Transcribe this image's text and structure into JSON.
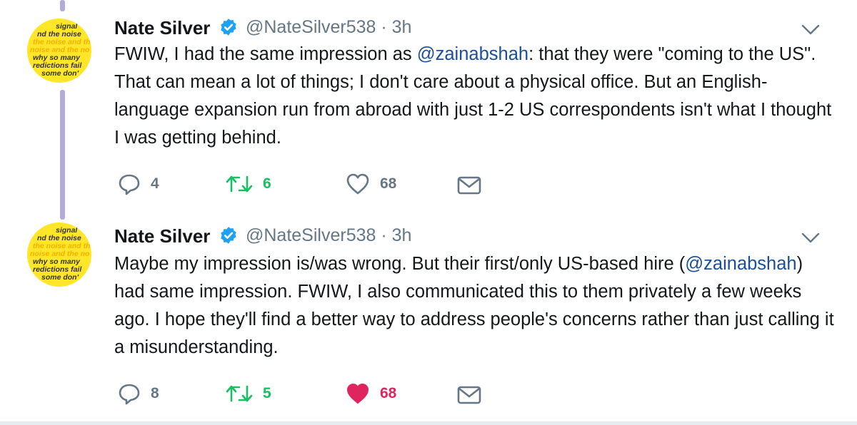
{
  "tweets": [
    {
      "author_name": "Nate Silver",
      "handle": "@NateSilver538",
      "separator": "·",
      "time": "3h",
      "text_before": "FWIW, I had the same impression as ",
      "mention": "@zainabshah",
      "text_after": ": that they were \"coming to the US\". That can mean a lot of things; I don't care about a physical office. But an English-language expansion run from abroad with just 1-2 US correspondents isn't what I thought I was getting behind.",
      "replies": "4",
      "retweets": "6",
      "likes": "68",
      "liked": false,
      "avatar_icon": "signal-noise-book-cover"
    },
    {
      "author_name": "Nate Silver",
      "handle": "@NateSilver538",
      "separator": "·",
      "time": "3h",
      "text_before": "Maybe my impression is/was wrong. But their first/only US-based hire (",
      "mention": "@zainabshah",
      "text_after": ") had same impression. FWIW, I also communicated this to them privately a few weeks ago. I hope they'll find a better way to address people's concerns rather than just calling it a misunderstanding.",
      "replies": "8",
      "retweets": "5",
      "likes": "68",
      "liked": true,
      "avatar_icon": "signal-noise-book-cover"
    }
  ],
  "avatar_text": {
    "line1": "signal",
    "line2": "nd the noise",
    "line3": "the noise and th",
    "line4": "noise and the no",
    "line5": "why so many",
    "line6": "redictions fail",
    "line7": "some don'"
  },
  "colors": {
    "thread_line": "#b3abd9",
    "verified": "#1da1f2",
    "retweet": "#17bf63",
    "like": "#e0245e",
    "mention": "#1b4f9a",
    "avatar_bg": "#ffe629"
  }
}
